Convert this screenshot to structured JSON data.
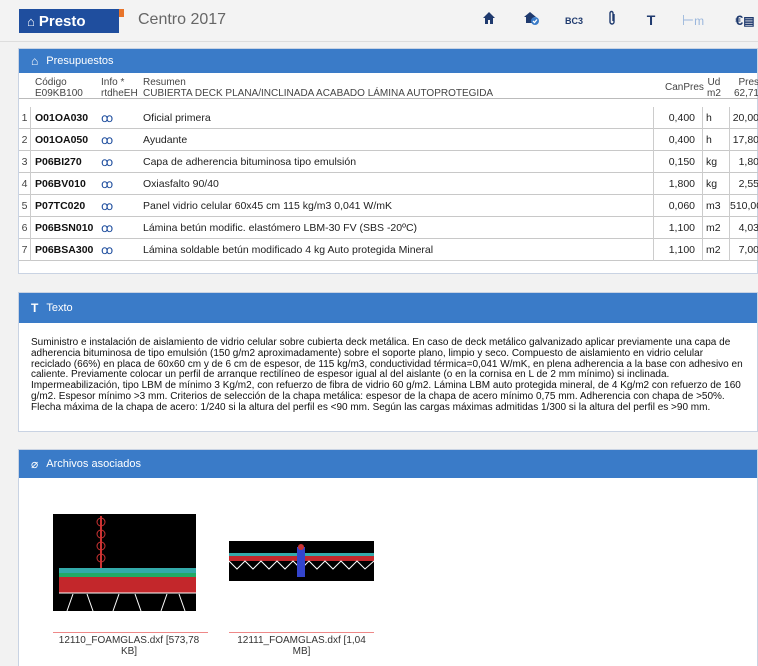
{
  "app": {
    "logo": "Presto",
    "project": "Centro 2017"
  },
  "toolbar": {
    "home": "home-icon",
    "certify": "document-check-icon",
    "bc3": "BC3",
    "attach": "paperclip-icon",
    "text": "T",
    "measure": "m",
    "money": "€"
  },
  "budget": {
    "title": "Presupuestos",
    "headers": {
      "code_label": "Código",
      "code_value": "E09KB100",
      "info_label": "Info *",
      "info_value": "rtdheEH",
      "summary_label": "Resumen",
      "summary_value": "CUBIERTA DECK PLANA/INCLINADA ACABADO LÁMINA AUTOPROTEGIDA",
      "qty_label": "CanPres",
      "unit_label": "Ud",
      "unit_value": "m2",
      "price_label": "Pres",
      "price_value": "62,71"
    },
    "rows": [
      {
        "n": "1",
        "code": "O01OA030",
        "desc": "Oficial primera",
        "qty": "0,400",
        "unit": "h",
        "price": "20,00"
      },
      {
        "n": "2",
        "code": "O01OA050",
        "desc": "Ayudante",
        "qty": "0,400",
        "unit": "h",
        "price": "17,80"
      },
      {
        "n": "3",
        "code": "P06BI270",
        "desc": "Capa de adherencia bituminosa tipo emulsión",
        "qty": "0,150",
        "unit": "kg",
        "price": "1,80"
      },
      {
        "n": "4",
        "code": "P06BV010",
        "desc": "Oxiasfalto 90/40",
        "qty": "1,800",
        "unit": "kg",
        "price": "2,55"
      },
      {
        "n": "5",
        "code": "P07TC020",
        "desc": "Panel vidrio celular 60x45 cm 115 kg/m3 0,041 W/mK",
        "qty": "0,060",
        "unit": "m3",
        "price": "510,00"
      },
      {
        "n": "6",
        "code": "P06BSN010",
        "desc": "Lámina betún modific. elastómero LBM-30 FV (SBS -20ºC)",
        "qty": "1,100",
        "unit": "m2",
        "price": "4,03"
      },
      {
        "n": "7",
        "code": "P06BSA300",
        "desc": "Lámina soldable betún modificado 4 kg Auto protegida Mineral",
        "qty": "1,100",
        "unit": "m2",
        "price": "7,00"
      }
    ]
  },
  "text_panel": {
    "title": "Texto",
    "body": "Suministro e instalación de aislamiento de vidrio celular sobre cubierta deck metálica. En caso de deck metálico galvanizado aplicar previamente una capa de adherencia bituminosa de tipo emulsión (150 g/m2 aproximadamente) sobre el soporte plano, limpio y seco. Compuesto de aislamiento en vidrio celular reciclado (66%) en placa de 60x60 cm y de 6 cm de espesor, de 115 kg/m3, conductividad térmica=0,041 W/mK, en plena adherencia a la base con adhesivo en caliente. Previamente colocar un perfil de arranque rectilíneo de espesor igual al del aislante (o en la cornisa en L de 2 mm mínimo) si inclinada. Impermeabilización, tipo LBM de mínimo 3 Kg/m2, con refuerzo de fibra de vidrio 60 g/m2. Lámina LBM auto protegida mineral, de 4 Kg/m2 con refuerzo de 160 g/m2. Espesor mínimo >3 mm. Criterios de selección de la chapa metálica: espesor de la chapa de acero mínimo 0,75 mm. Adherencia con chapa de >50%. Flecha máxima de la chapa de acero: 1/240 si la altura del perfil es <90 mm. Según las cargas máximas admitidas 1/300 si la altura del perfil es >90 mm."
  },
  "files_panel": {
    "title": "Archivos asociados",
    "files": [
      {
        "name_line1": "12110_FOAMGLAS.dxf [573,78",
        "name_line2": "KB]"
      },
      {
        "name_line1": "12111_FOAMGLAS.dxf [1,04",
        "name_line2": "MB]"
      }
    ]
  },
  "colors": {
    "header_blue": "#3a7bc8",
    "logo_blue": "#1f4e9e",
    "accent_orange": "#e8742a"
  }
}
